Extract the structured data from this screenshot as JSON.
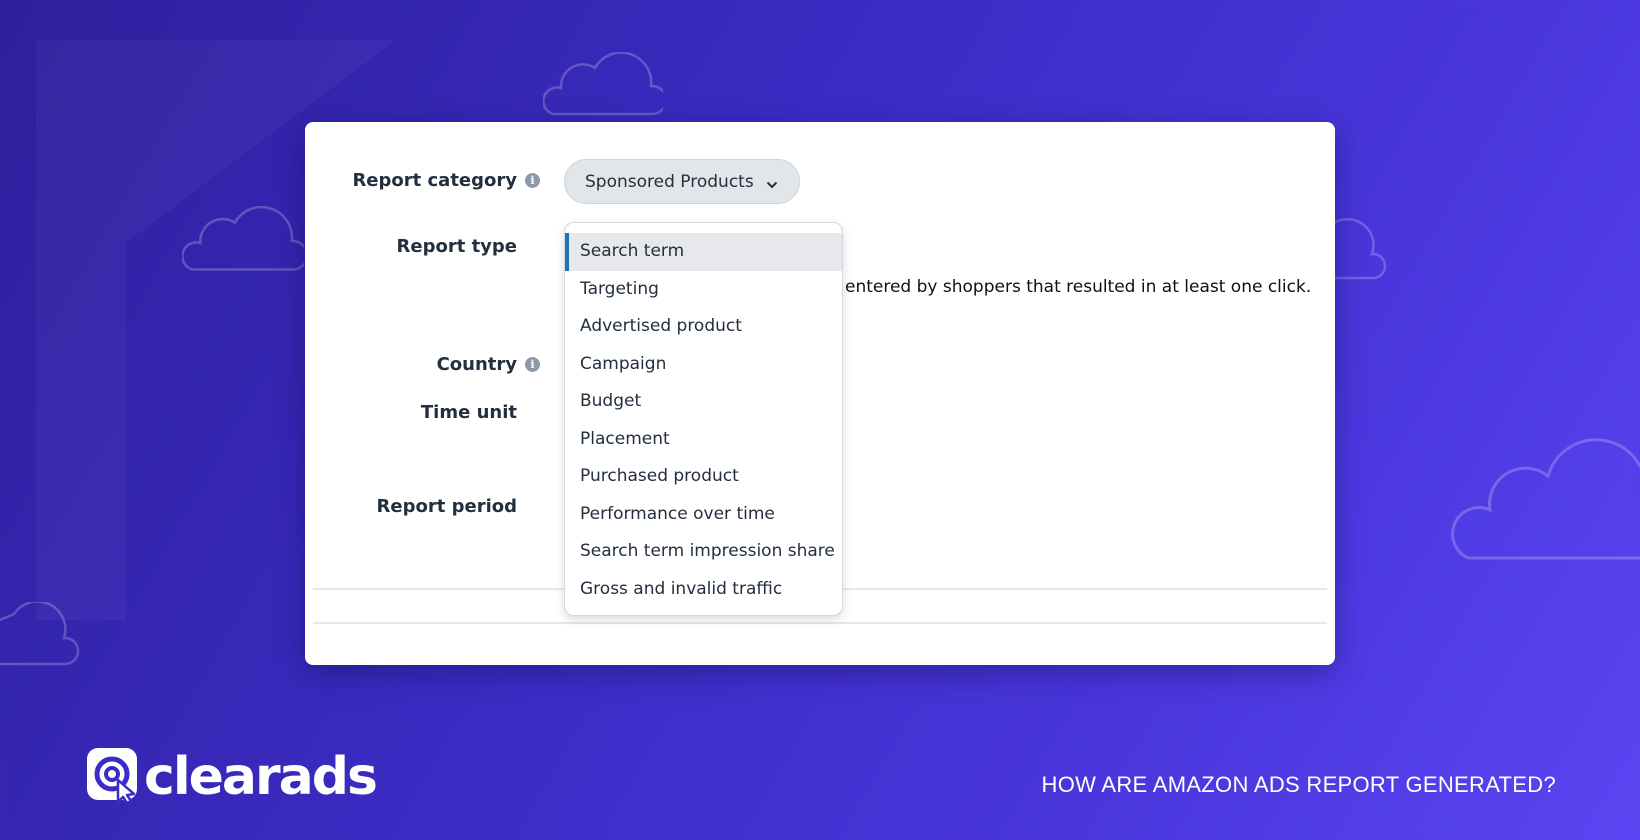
{
  "form": {
    "report_category": {
      "label": "Report category",
      "selected_value": "Sponsored Products"
    },
    "report_type": {
      "label": "Report type",
      "description": "entered by shoppers that resulted in at least one click.",
      "link_fragment": "rt"
    },
    "country": {
      "label": "Country"
    },
    "time_unit": {
      "label": "Time unit"
    },
    "report_period": {
      "label": "Report period"
    }
  },
  "dropdown": {
    "selected_index": 0,
    "options": [
      "Search term",
      "Targeting",
      "Advertised product",
      "Campaign",
      "Budget",
      "Placement",
      "Purchased product",
      "Performance over time",
      "Search term impression share",
      "Gross and invalid traffic"
    ]
  },
  "branding": {
    "logo_text": "clearads",
    "footer_title": "HOW ARE AMAZON ADS REPORT GENERATED?"
  },
  "icons": {
    "info": "info-icon",
    "chevron": "chevron-down-icon",
    "cloud": "cloud-icon",
    "logo_mark": "at-cursor-logo-icon"
  },
  "colors": {
    "background_start": "#2f1f9c",
    "background_end": "#5a45f2",
    "selected_accent": "#1f73b7",
    "link": "#0a66a8",
    "text_dark": "#232f3e"
  }
}
